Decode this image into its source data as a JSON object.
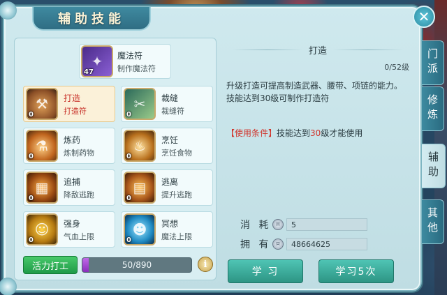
{
  "window": {
    "title": "辅助技能"
  },
  "featured": {
    "name": "魔法符",
    "sub": "制作魔法符",
    "count": "47",
    "icon": "magic-talisman-icon"
  },
  "skills": [
    {
      "name": "打造",
      "sub": "打造符",
      "count": "0",
      "icon": "forge-icon",
      "active": true
    },
    {
      "name": "裁缝",
      "sub": "裁缝符",
      "count": "0",
      "icon": "sewing-icon"
    },
    {
      "name": "炼药",
      "sub": "炼制药物",
      "count": "0",
      "icon": "alchemy-icon"
    },
    {
      "name": "烹饪",
      "sub": "烹饪食物",
      "count": "0",
      "icon": "cooking-icon"
    },
    {
      "name": "追捕",
      "sub": "降敌逃跑",
      "count": "0",
      "icon": "hunt-cage-icon"
    },
    {
      "name": "逃离",
      "sub": "提升逃跑",
      "count": "0",
      "icon": "escape-cage-icon"
    },
    {
      "name": "强身",
      "sub": "气血上限",
      "count": "0",
      "icon": "strength-icon"
    },
    {
      "name": "冥想",
      "sub": "魔法上限",
      "count": "0",
      "icon": "meditation-icon"
    }
  ],
  "vitality": {
    "button_label": "活力打工",
    "current": 50,
    "max": 890,
    "text": "50/890",
    "fill_fraction": 0.056
  },
  "detail": {
    "title": "打造",
    "level": "0/52级",
    "description": "升级打造可提高制造武器、腰带、项链的能力。技能达到30级可制作打造符",
    "condition_tag": "【使用条件】",
    "condition_pre": "技能达到",
    "condition_num": "30",
    "condition_post": "级才能使用"
  },
  "cost": {
    "label": "消 耗",
    "value": "5"
  },
  "owned": {
    "label": "拥 有",
    "value": "48664625"
  },
  "buttons": {
    "learn": "学 习",
    "learn5": "学习5次"
  },
  "side_tabs": [
    "门派",
    "修炼",
    "辅助",
    "其他"
  ],
  "active_side_tab": "辅助",
  "colors": {
    "accent": "#2d9584",
    "highlight": "#d0332a",
    "progress": "#8a2ebc"
  }
}
